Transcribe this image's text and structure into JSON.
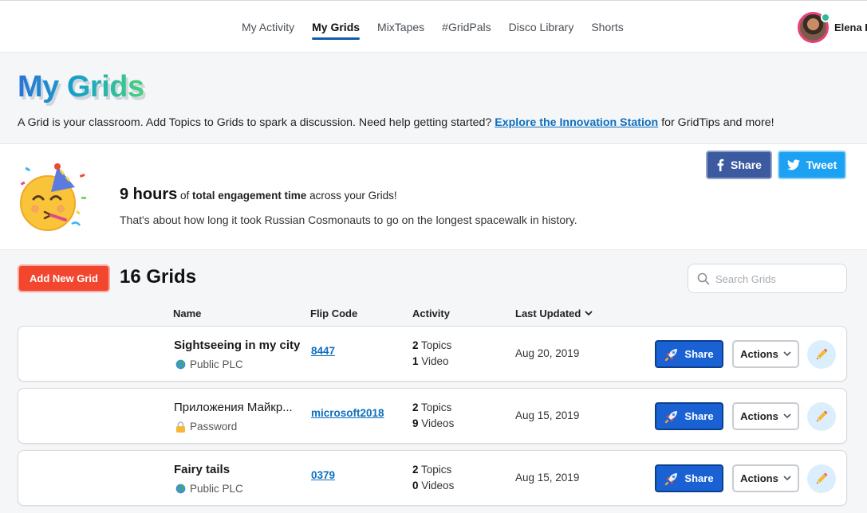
{
  "nav": {
    "items": [
      "My Activity",
      "My Grids",
      "MixTapes",
      "#GridPals",
      "Disco Library",
      "Shorts"
    ],
    "active": "My Grids",
    "username": "Elena I"
  },
  "header": {
    "title": "My Grids",
    "intro_text": "A Grid is your classroom. Add Topics to Grids to spark a discussion. Need help getting started?",
    "intro_link": "Explore the Innovation Station",
    "intro_suffix": "for GridTips and more!"
  },
  "engagement": {
    "hours": "9 hours",
    "of": "of",
    "metric": "total engagement time",
    "suffix": "across your Grids!",
    "subtext": "That's about how long it took Russian Cosmonauts to go on the longest spacewalk in history.",
    "share_label": "Share",
    "tweet_label": "Tweet"
  },
  "toolbar": {
    "add_label": "Add New Grid",
    "count_label": "16 Grids",
    "search_placeholder": "Search Grids"
  },
  "columns": {
    "name": "Name",
    "flip_code": "Flip Code",
    "activity": "Activity",
    "last_updated": "Last Updated"
  },
  "grids": [
    {
      "name": "Sightseeing in my city",
      "privacy": "Public PLC",
      "privacy_icon": "globe-icon",
      "flip_code": "8447",
      "topics_count": "2",
      "topics_label": "Topics",
      "videos_count": "1",
      "videos_label": "Video",
      "updated": "Aug 20, 2019",
      "share_label": "Share",
      "actions_label": "Actions"
    },
    {
      "name": "Приложения Майкр...",
      "privacy": "Password",
      "privacy_icon": "lock-icon",
      "flip_code": "microsoft2018",
      "topics_count": "2",
      "topics_label": "Topics",
      "videos_count": "9",
      "videos_label": "Videos",
      "updated": "Aug 15, 2019",
      "share_label": "Share",
      "actions_label": "Actions"
    },
    {
      "name": "Fairy tails",
      "privacy": "Public PLC",
      "privacy_icon": "globe-icon",
      "flip_code": "0379",
      "topics_count": "2",
      "topics_label": "Topics",
      "videos_count": "0",
      "videos_label": "Videos",
      "updated": "Aug 15, 2019",
      "share_label": "Share",
      "actions_label": "Actions"
    }
  ],
  "colors": {
    "accent_blue": "#1a62d4",
    "add_button": "#f2462e",
    "facebook": "#3b5aa0",
    "twitter": "#1da1f2",
    "link": "#0d6fbf"
  }
}
